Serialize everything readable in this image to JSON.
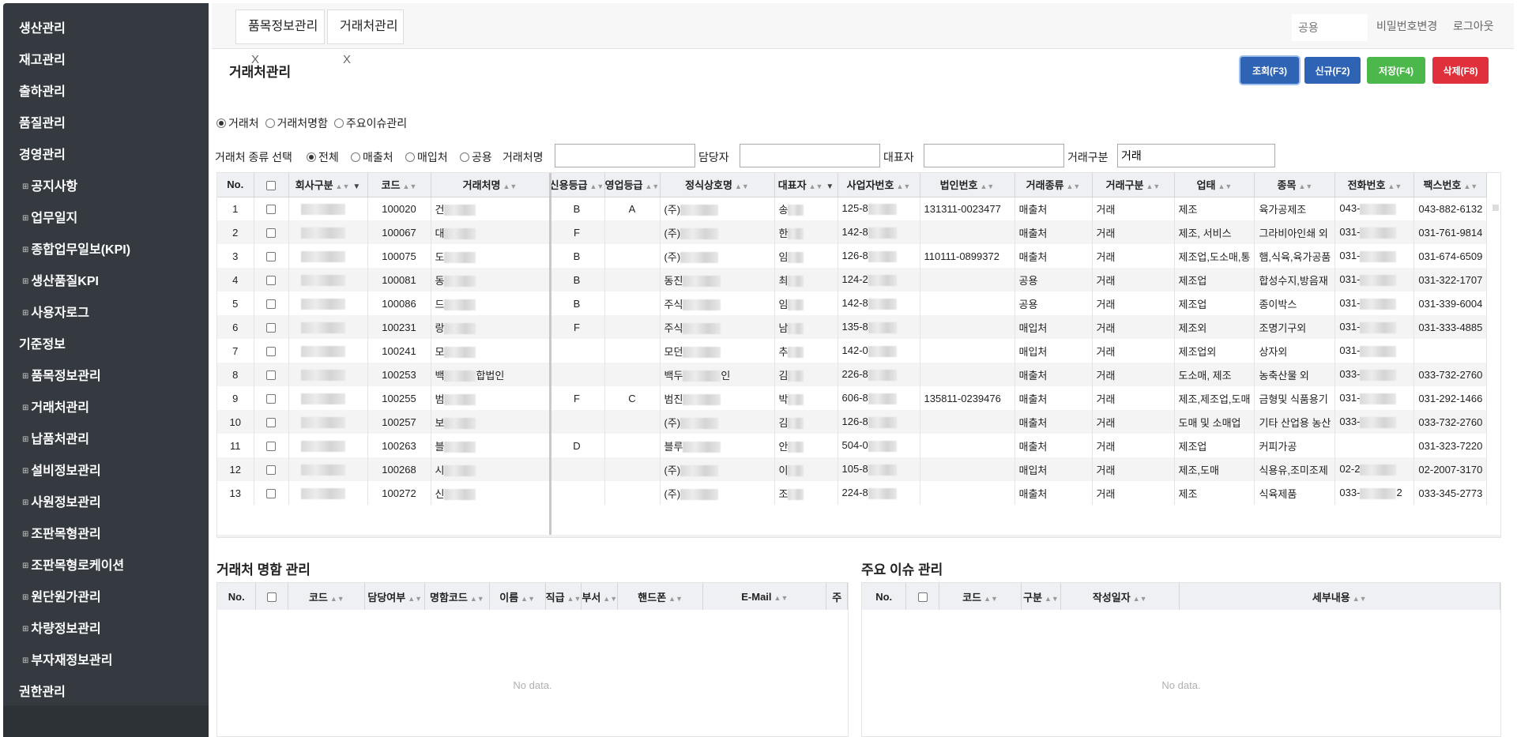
{
  "sidebar": {
    "items": [
      {
        "label": "생산관리",
        "sub": false
      },
      {
        "label": "재고관리",
        "sub": false
      },
      {
        "label": "출하관리",
        "sub": false
      },
      {
        "label": "품질관리",
        "sub": false
      },
      {
        "label": "경영관리",
        "sub": false
      },
      {
        "label": "공지사항",
        "sub": true
      },
      {
        "label": "업무일지",
        "sub": true
      },
      {
        "label": "종합업무일보(KPI)",
        "sub": true
      },
      {
        "label": "생산품질KPI",
        "sub": true
      },
      {
        "label": "사용자로그",
        "sub": true
      },
      {
        "label": "기준정보",
        "sub": false
      },
      {
        "label": "품목정보관리",
        "sub": true
      },
      {
        "label": "거래처관리",
        "sub": true
      },
      {
        "label": "납품처관리",
        "sub": true
      },
      {
        "label": "설비정보관리",
        "sub": true
      },
      {
        "label": "사원정보관리",
        "sub": true
      },
      {
        "label": "조판목형관리",
        "sub": true
      },
      {
        "label": "조판목형로케이션",
        "sub": true
      },
      {
        "label": "원단원가관리",
        "sub": true
      },
      {
        "label": "차량정보관리",
        "sub": true
      },
      {
        "label": "부자재정보관리",
        "sub": true
      },
      {
        "label": "권한관리",
        "sub": false
      }
    ]
  },
  "tabs": [
    {
      "label": "품목정보관리",
      "close": "X"
    },
    {
      "label": "거래처관리",
      "close": "X"
    }
  ],
  "topbar": {
    "shared_placeholder": "공용",
    "change_password": "비밀번호변경",
    "logout": "로그아웃"
  },
  "page": {
    "title": "거래처관리",
    "buttons": {
      "query": "조회(F3)",
      "new": "신규(F2)",
      "save": "저장(F4)",
      "delete": "삭제(F8)"
    },
    "mode_radios": [
      "거래처",
      "거래처명함",
      "주요이슈관리"
    ],
    "filter": {
      "type_label": "거래처 종류 선택",
      "type_options": [
        "전체",
        "매출처",
        "매입처",
        "공용"
      ],
      "name_label": "거래처명",
      "manager_label": "담당자",
      "ceo_label": "대표자",
      "category_label": "거래구분",
      "category_value": "거래"
    }
  },
  "grid": {
    "columns": [
      "No.",
      "",
      "회사구분",
      "코드",
      "거래처명",
      "신용등급",
      "영업등급",
      "정식상호명",
      "대표자",
      "사업자번호",
      "법인번호",
      "거래종류",
      "거래구분",
      "업태",
      "종목",
      "전화번호",
      "팩스번호"
    ],
    "rows": [
      {
        "no": "1",
        "code": "100020",
        "name": "건",
        "credit": "B",
        "sales": "A",
        "official": "(주)",
        "ceo": "송",
        "biz": "125-8",
        "corp": "131311-0023477",
        "kind": "매출처",
        "cat": "거래",
        "btype": "제조",
        "item": "육가공제조",
        "tel": "043-",
        "fax": "043-882-6132"
      },
      {
        "no": "2",
        "code": "100067",
        "name": "대",
        "credit": "F",
        "sales": "",
        "official": "(주)",
        "ceo": "한",
        "biz": "142-8",
        "corp": "",
        "kind": "매출처",
        "cat": "거래",
        "btype": "제조, 서비스",
        "item": "그라비아인쇄 외",
        "tel": "031-",
        "fax": "031-761-9814"
      },
      {
        "no": "3",
        "code": "100075",
        "name": "도",
        "credit": "B",
        "sales": "",
        "official": "(주)",
        "ceo": "임",
        "biz": "126-8",
        "corp": "110111-0899372",
        "kind": "매출처",
        "cat": "거래",
        "btype": "제조업,도소매,통",
        "item": "햄,식육,육가공품",
        "tel": "031-",
        "fax": "031-674-6509"
      },
      {
        "no": "4",
        "code": "100081",
        "name": "동",
        "credit": "B",
        "sales": "",
        "official": "동진",
        "ceo": "최",
        "biz": "124-2",
        "corp": "",
        "kind": "공용",
        "cat": "거래",
        "btype": "제조업",
        "item": "합성수지,방음재",
        "tel": "031-",
        "fax": "031-322-1707"
      },
      {
        "no": "5",
        "code": "100086",
        "name": "드",
        "credit": "B",
        "sales": "",
        "official": "주식",
        "ceo": "임",
        "biz": "142-8",
        "corp": "",
        "kind": "공용",
        "cat": "거래",
        "btype": "제조업",
        "item": "종이박스",
        "tel": "031-",
        "fax": "031-339-6004"
      },
      {
        "no": "6",
        "code": "100231",
        "name": "랑",
        "credit": "F",
        "sales": "",
        "official": "주식",
        "ceo": "남",
        "biz": "135-8",
        "corp": "",
        "kind": "매입처",
        "cat": "거래",
        "btype": "제조외",
        "item": "조명기구외",
        "tel": "031-",
        "fax": "031-333-4885"
      },
      {
        "no": "7",
        "code": "100241",
        "name": "모",
        "credit": "",
        "sales": "",
        "official": "모던",
        "ceo": "추",
        "biz": "142-0",
        "corp": "",
        "kind": "매입처",
        "cat": "거래",
        "btype": "제조업외",
        "item": "상자외",
        "tel": "031-",
        "fax": ""
      },
      {
        "no": "8",
        "code": "100253",
        "name": "백",
        "name2": "합법인",
        "credit": "",
        "sales": "",
        "official": "백두",
        "official2": "인",
        "ceo": "김",
        "biz": "226-8",
        "corp": "",
        "kind": "매출처",
        "cat": "거래",
        "btype": "도소매, 제조",
        "item": "농축산물 외",
        "tel": "033-",
        "fax": "033-732-2760"
      },
      {
        "no": "9",
        "code": "100255",
        "name": "범",
        "credit": "F",
        "sales": "C",
        "official": "범진",
        "ceo": "박",
        "biz": "606-8",
        "corp": "135811-0239476",
        "kind": "매출처",
        "cat": "거래",
        "btype": "제조,제조업,도매",
        "item": "금형및 식품용기",
        "tel": "031-",
        "fax": "031-292-1466"
      },
      {
        "no": "10",
        "code": "100257",
        "name": "보",
        "credit": "",
        "sales": "",
        "official": "(주)",
        "ceo": "김",
        "biz": "126-8",
        "corp": "",
        "kind": "매출처",
        "cat": "거래",
        "btype": "도매 및 소매업",
        "item": "기타 산업용 농산",
        "tel": "033-",
        "fax": "033-732-2760"
      },
      {
        "no": "11",
        "code": "100263",
        "name": "블",
        "credit": "D",
        "sales": "",
        "official": "블루",
        "ceo": "안",
        "biz": "504-0",
        "corp": "",
        "kind": "매출처",
        "cat": "거래",
        "btype": "제조업",
        "item": "커피가공",
        "tel": "",
        "fax": "031-323-7220"
      },
      {
        "no": "12",
        "code": "100268",
        "name": "시",
        "credit": "",
        "sales": "",
        "official": "(주)",
        "ceo": "이",
        "biz": "105-8",
        "corp": "",
        "kind": "매입처",
        "cat": "거래",
        "btype": "제조,도매",
        "item": "식용유,조미조제",
        "tel": "02-2",
        "fax": "02-2007-3170"
      },
      {
        "no": "13",
        "code": "100272",
        "name": "신",
        "credit": "",
        "sales": "",
        "official": "(주)",
        "ceo": "조",
        "biz": "224-8",
        "corp": "",
        "kind": "매출처",
        "cat": "거래",
        "btype": "제조",
        "item": "식육제품",
        "tel": "033-",
        "tel2": "2",
        "fax": "033-345-2773"
      }
    ]
  },
  "card_section": {
    "title": "거래처 명함 관리",
    "columns": [
      "No.",
      "",
      "코드",
      "담당여부",
      "명함코드",
      "이름",
      "직급",
      "부서",
      "핸드폰",
      "E-Mail",
      "주"
    ],
    "empty": "No data."
  },
  "issue_section": {
    "title": "주요 이슈 관리",
    "columns": [
      "No.",
      "",
      "코드",
      "구분",
      "작성일자",
      "세부내용"
    ],
    "empty": "No data."
  }
}
